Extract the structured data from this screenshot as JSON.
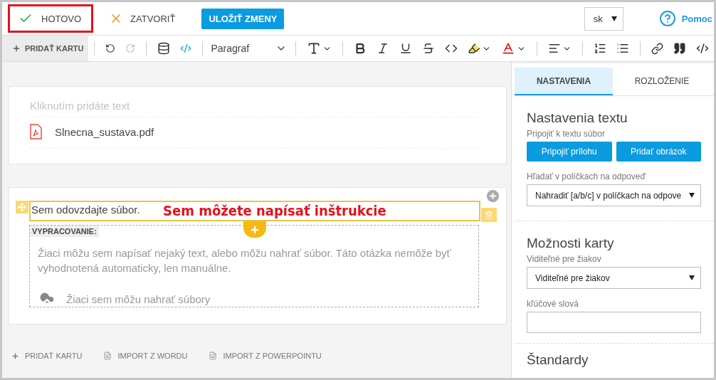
{
  "top_bar": {
    "done_button": {
      "label": "HOTOVO",
      "highlighted": true
    },
    "close_button": {
      "label": "ZATVORIŤ"
    },
    "save_button": {
      "label": "ULOŽIŤ ZMENY"
    },
    "language_select": {
      "value": "sk"
    },
    "help_link": {
      "label": "Pomoc"
    }
  },
  "toolbar": {
    "add_card": {
      "label": "PRIDAŤ KARTU"
    },
    "block_format": {
      "value": "Paragraf"
    }
  },
  "cards": [
    {
      "kind": "text",
      "placeholder": "Kliknutím pridáte text",
      "attachment": "Slnecna_sustava.pdf"
    },
    {
      "kind": "question",
      "instructions": "Sem odovzdajte súbor.",
      "annotation": "Sem môžete napísať inštrukcie",
      "answer_label": "VYPRACOVANIE:",
      "answer_note": "Žiaci môžu sem napísať nejaký text, alebo môžu nahrať súbor. Táto otázka nemôže byť vyhodnotená automaticky, len manuálne.",
      "upload_label": "Žiaci sem môžu nahrať súbory"
    }
  ],
  "footer_actions": [
    {
      "kind": "add",
      "label": "PRIDAŤ KARTU"
    },
    {
      "kind": "word",
      "label": "IMPORT Z WORDU"
    },
    {
      "kind": "powerpoint",
      "label": "IMPORT Z POWERPOINTU"
    }
  ],
  "panel": {
    "tabs": [
      {
        "label": "NASTAVENIA",
        "selected": true
      },
      {
        "label": "ROZLOŽENIE",
        "selected": false
      }
    ],
    "text_settings": {
      "title": "Nastavenia textu",
      "attach_label": "Pripojiť k textu súbor",
      "buttons": [
        "Pripojiť prílohu",
        "Pridať obrázok"
      ],
      "search_label": "Hľadať v políčkach na odpoveď",
      "search_value": "Nahradiť [a/b/c] v políčkach na odpove"
    },
    "card_options": {
      "title": "Možnosti karty",
      "visibility_label": "Viditeľné pre žiakov",
      "visibility_value": "Viditeľné pre žiakov",
      "keywords_label": "kľúčové slová"
    },
    "standards": {
      "title": "Štandardy"
    }
  }
}
